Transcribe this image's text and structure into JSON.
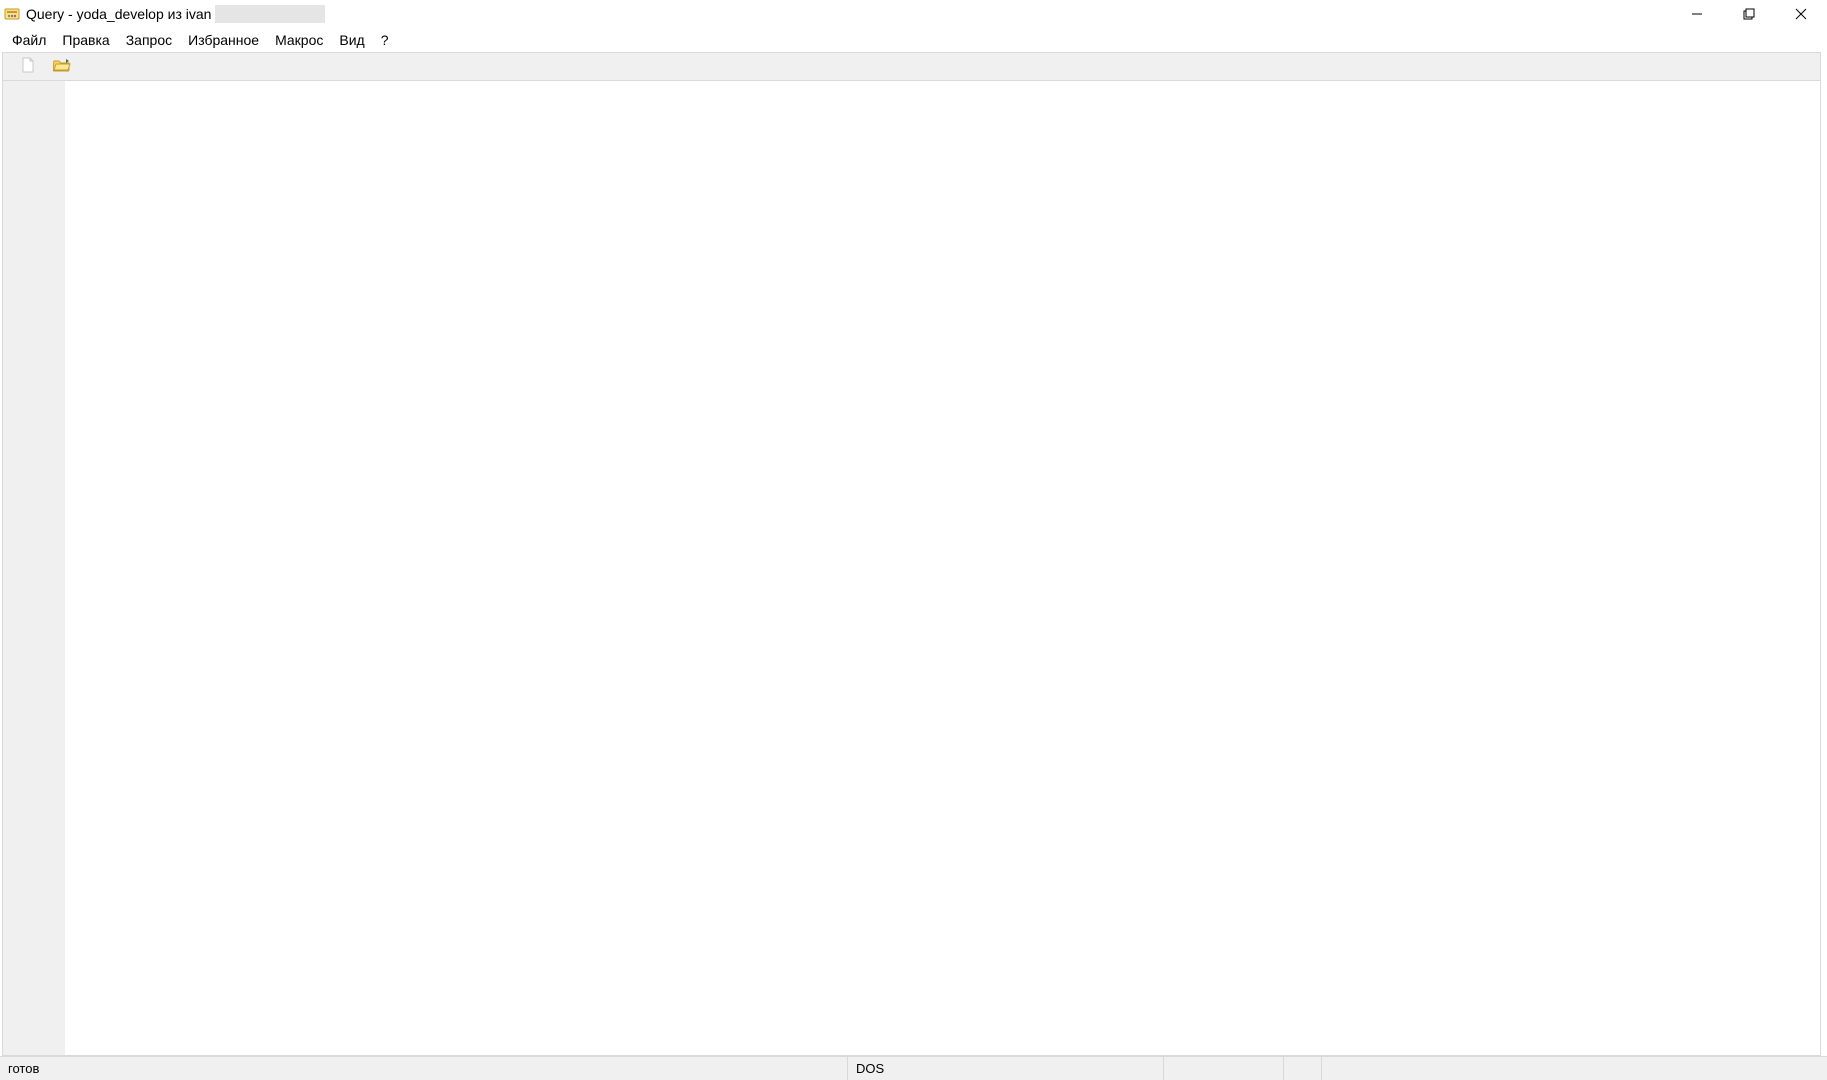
{
  "title": "Query - yoda_develop из ivan",
  "menu": {
    "file": "Файл",
    "edit": "Правка",
    "query": "Запрос",
    "favorites": "Избранное",
    "macro": "Макрос",
    "view": "Вид",
    "help": "?"
  },
  "status": {
    "ready": "готов",
    "encoding": "DOS"
  }
}
